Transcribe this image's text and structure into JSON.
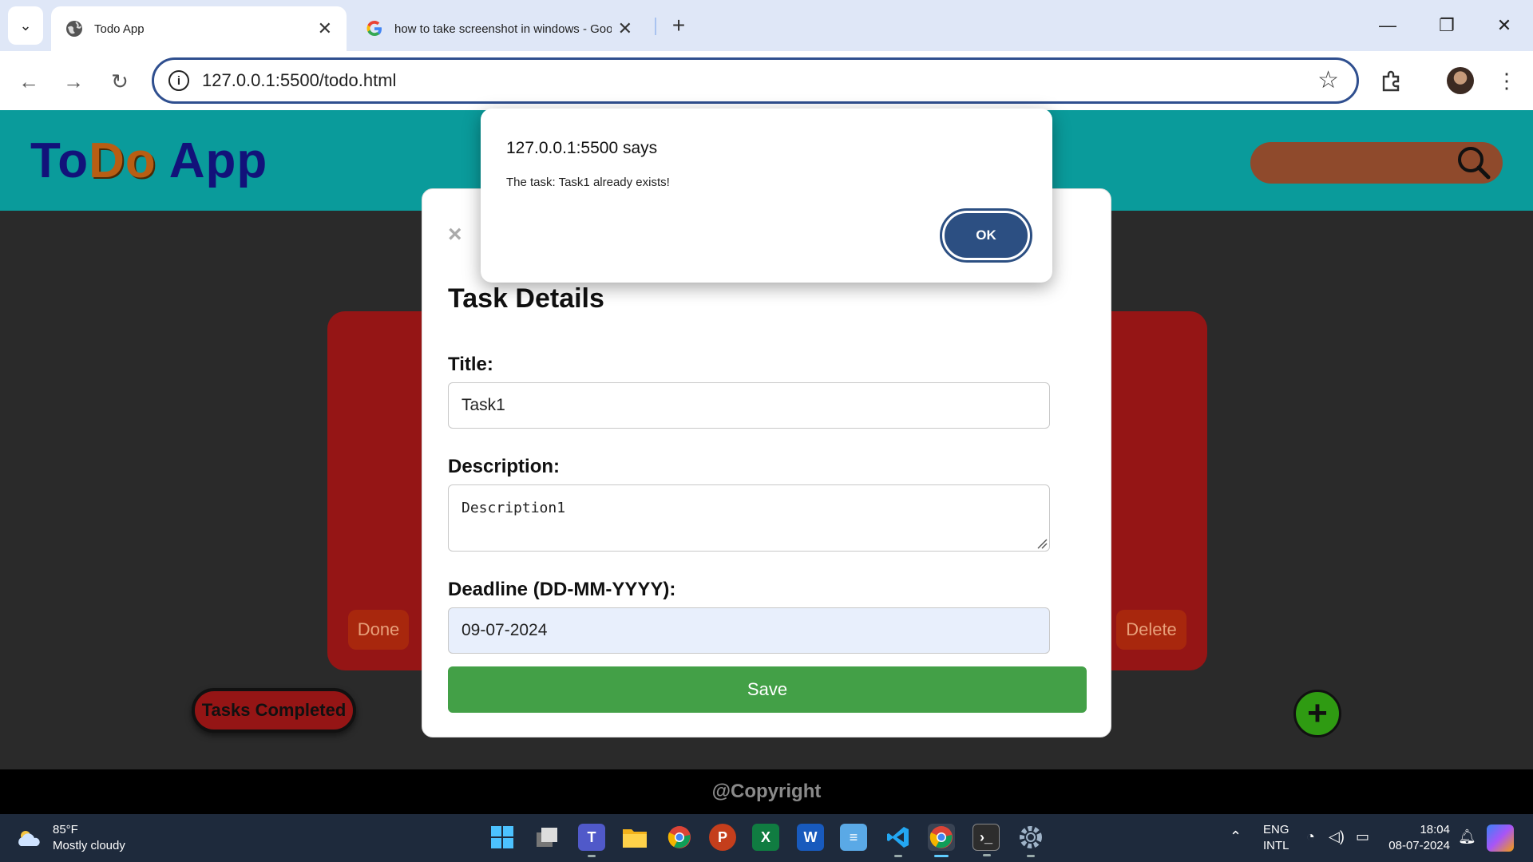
{
  "browser": {
    "tabs": [
      {
        "title": "Todo App",
        "active": true
      },
      {
        "title": "how to take screenshot in windows - Goo",
        "active": false
      }
    ],
    "url": "127.0.0.1:5500/todo.html"
  },
  "app": {
    "logo": {
      "part1": "To",
      "part2": "Do",
      "part3": " App"
    },
    "footer": "@Copyright",
    "card_buttons": {
      "done": "Done",
      "delete": "Delete"
    },
    "tasks_completed_label": "Tasks Completed",
    "add_button_label": "+"
  },
  "modal": {
    "close_label": "×",
    "title": "Task Details",
    "title_label": "Title:",
    "title_value": "Task1",
    "description_label": "Description:",
    "description_value": "Description1",
    "deadline_label": "Deadline (DD-MM-YYYY):",
    "deadline_value": "09-07-2024",
    "save_label": "Save"
  },
  "alert": {
    "title": "127.0.0.1:5500 says",
    "message": "The task: Task1 already exists!",
    "ok_label": "OK"
  },
  "taskbar": {
    "weather_temp": "85°F",
    "weather_desc": "Mostly cloudy",
    "lang_top": "ENG",
    "lang_bottom": "INTL",
    "time": "18:04",
    "date": "08-07-2024",
    "apps": [
      "start-icon",
      "task-view-icon",
      "teams-icon",
      "file-explorer-icon",
      "chrome-icon",
      "powerpoint-icon",
      "excel-icon",
      "word-icon",
      "notepad-icon",
      "vscode-icon",
      "chrome-profile-icon",
      "terminal-icon",
      "settings-icon"
    ]
  },
  "colors": {
    "header": "#0a9b9b",
    "card": "#951515",
    "save": "#43a047",
    "ok": "#2c4f82",
    "add": "#2f9b12"
  }
}
